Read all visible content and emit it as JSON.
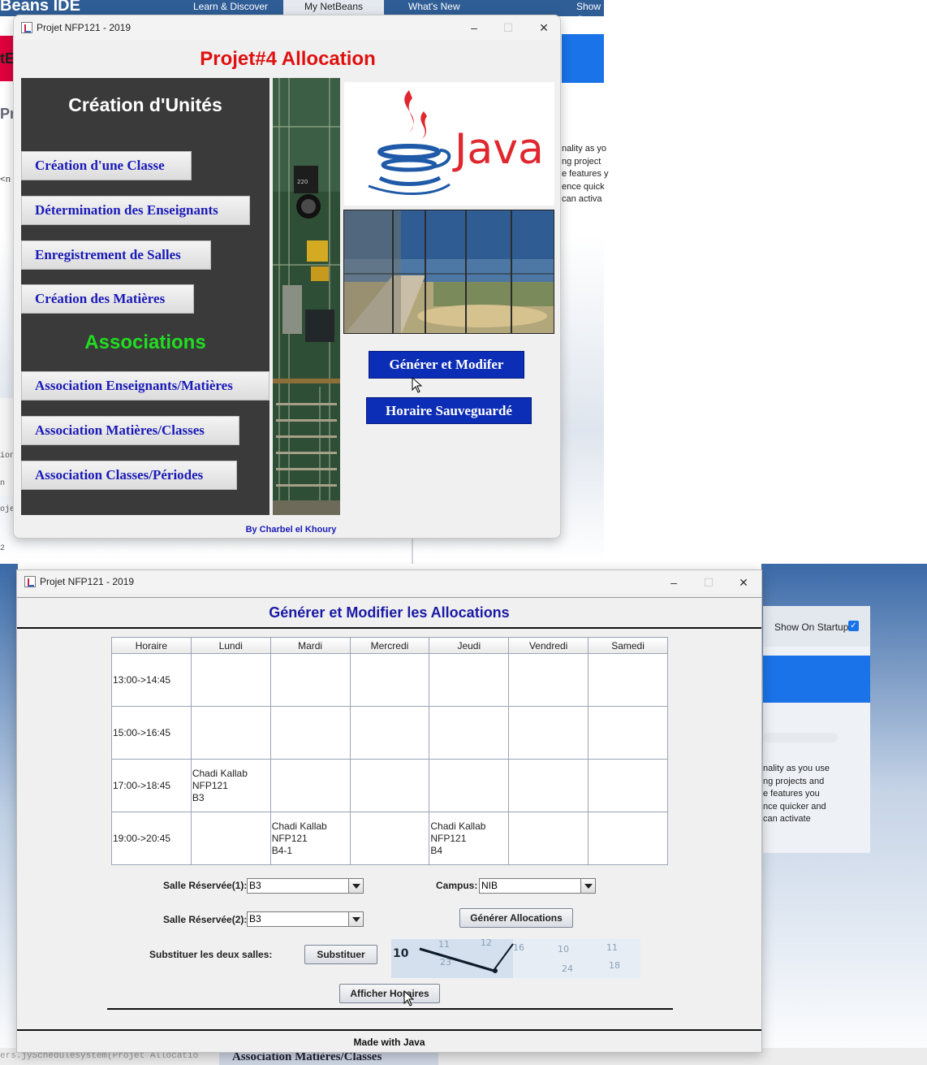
{
  "background": {
    "ide_logo": "Beans IDE",
    "tabs": [
      "Learn & Discover",
      "My NetBeans",
      "What's New",
      "Show C"
    ],
    "snippet_lines_top": "nality as yo\nng project\ne features y\nence quick\ncan activa",
    "snippet_lines_bottom": "nality as you use\nng projects and\ne features you\nnce quicker and\ncan activate",
    "show_on_startup": "Show On Startup",
    "left_fragments": [
      "tE",
      "Pr",
      "<n",
      "ion",
      "n 2",
      "oje"
    ],
    "bottom_code": "ers.jySchedulesystem(Projet Allocatio",
    "bottom_button_fragment": "Association Matières/Classes"
  },
  "window1": {
    "title": "Projet NFP121 - 2019",
    "heading": "Projet#4 Allocation",
    "units_heading": "Création d'Unités",
    "associations_heading": "Associations",
    "unit_buttons": [
      "Création d'une Classe",
      "Détermination des Enseignants",
      "Enregistrement de Salles",
      "Création des Matières"
    ],
    "association_buttons": [
      "Association Enseignants/Matières",
      "Association Matières/Classes",
      "Association Classes/Périodes"
    ],
    "java_logo_text": "Java",
    "generate_button": "Générer et Modifer",
    "saved_button": "Horaire Sauveguardé",
    "byline": "By Charbel el Khoury"
  },
  "window2": {
    "title": "Projet NFP121 - 2019",
    "heading": "Générer et Modifier les Allocations",
    "table": {
      "columns": [
        "Horaire",
        "Lundi",
        "Mardi",
        "Mercredi",
        "Jeudi",
        "Vendredi",
        "Samedi"
      ],
      "rows": [
        [
          "13:00->14:45",
          "",
          "",
          "",
          "",
          "",
          ""
        ],
        [
          "15:00->16:45",
          "",
          "",
          "",
          "",
          "",
          ""
        ],
        [
          "17:00->18:45",
          "Chadi Kallab\nNFP121\nB3",
          "",
          "",
          "",
          "",
          ""
        ],
        [
          "19:00->20:45",
          "",
          "Chadi Kallab\nNFP121\nB4-1",
          "",
          "Chadi Kallab\nNFP121\nB4",
          "",
          ""
        ]
      ]
    },
    "salle1_label": "Salle Réservée(1):",
    "salle1_value": "B3",
    "salle2_label": "Salle Réservée(2):",
    "salle2_value": "B3",
    "campus_label": "Campus:",
    "campus_value": "NIB",
    "generate_button": "Générer Allocations",
    "substitute_label": "Substituer les deux salles:",
    "substitute_button": "Substituer",
    "show_button": "Afficher Horaires",
    "footer": "Made with Java"
  },
  "colors": {
    "heading_red": "#e01010",
    "associations_green": "#22dd22",
    "button_blue": "#0c2db5",
    "menu_text_blue": "#1a1ab8",
    "title_blue": "#1a1aa6"
  }
}
